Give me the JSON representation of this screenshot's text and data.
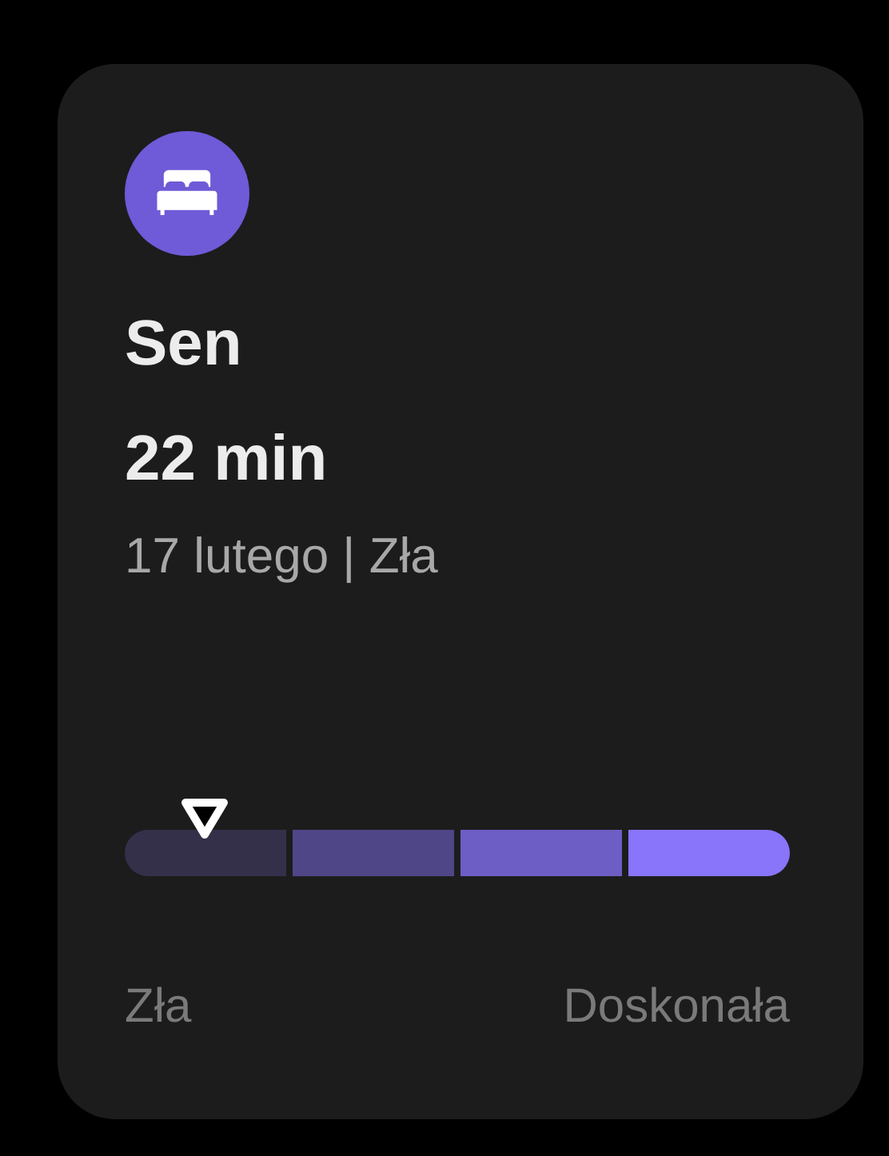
{
  "card": {
    "title": "Sen",
    "value": "22 min",
    "subtitle": "17 lutego | Zła",
    "scale": {
      "min_label": "Zła",
      "max_label": "Doskonała",
      "segments": [
        {
          "color": "#34304a"
        },
        {
          "color": "#4f4688"
        },
        {
          "color": "#6c5ec4"
        },
        {
          "color": "#8875fa"
        }
      ]
    }
  }
}
